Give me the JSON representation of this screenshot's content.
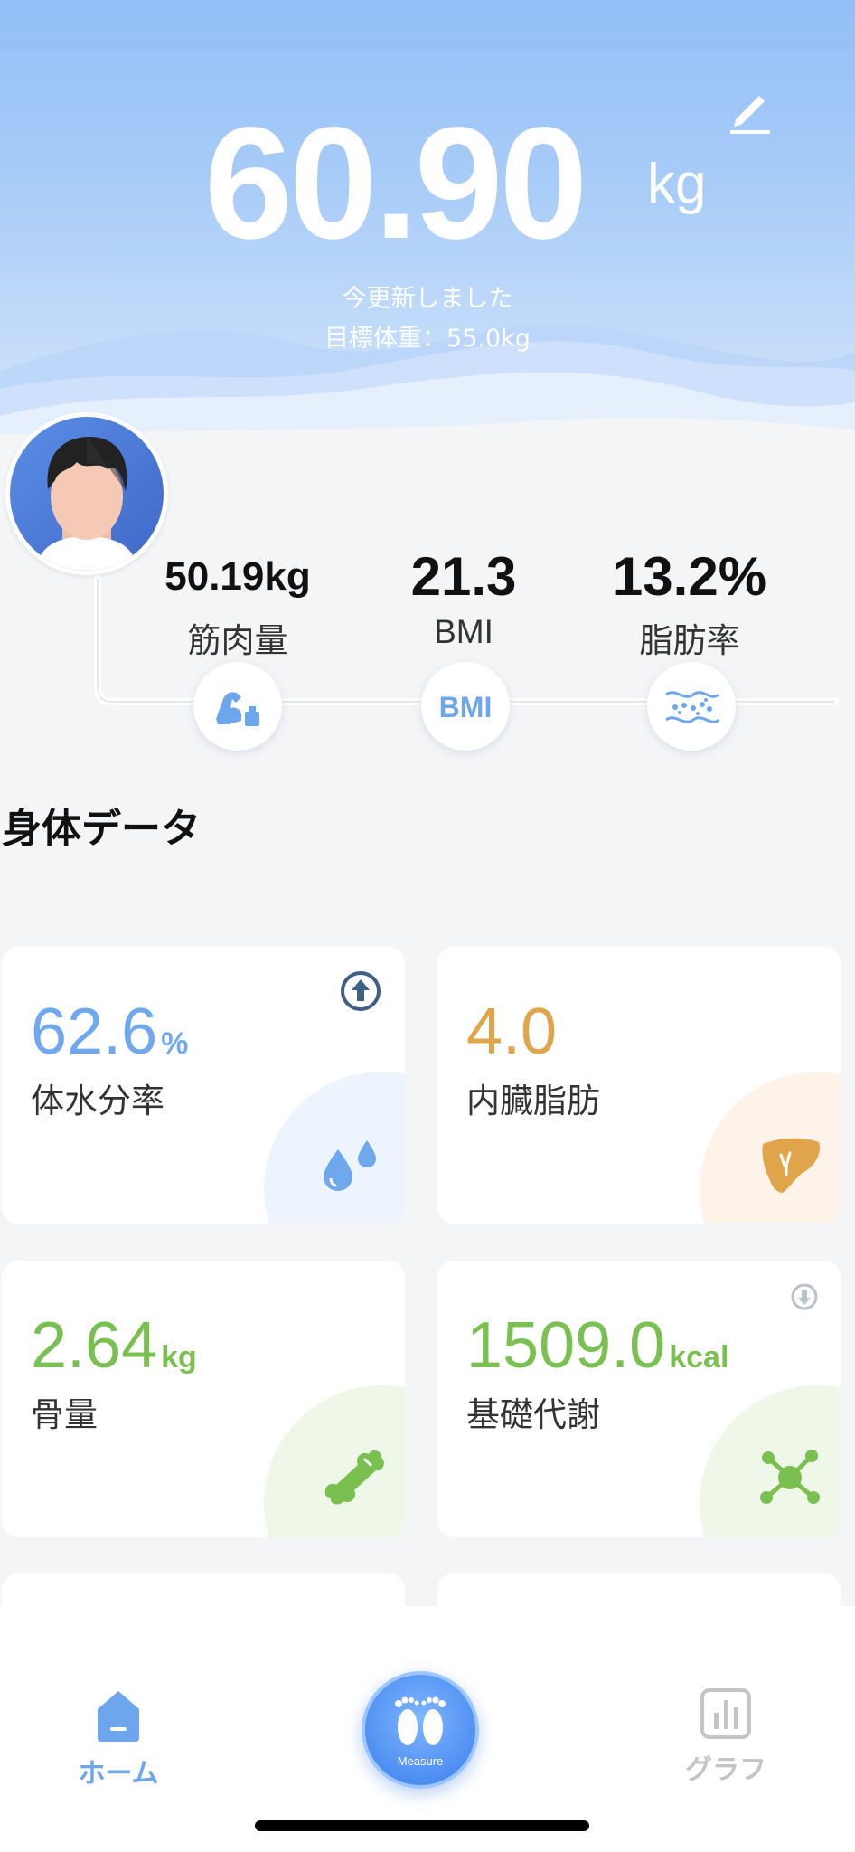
{
  "header": {
    "weight_value": "60.90",
    "weight_unit": "kg",
    "update_text": "今更新しました",
    "target_text": "目標体重：55.0kg"
  },
  "icons": {
    "edit": "pencil-icon",
    "muscle": "muscle-icon",
    "bmi": "bmi-icon",
    "fat": "fat-tissue-icon",
    "water": "water-drop-icon",
    "visceral": "liver-icon",
    "bone": "bone-icon",
    "metabolism": "molecule-icon",
    "home": "home-icon",
    "measure": "footprints-icon",
    "graph": "bar-chart-icon"
  },
  "metrics": [
    {
      "value": "50.19kg",
      "label": "筋肉量"
    },
    {
      "value": "21.3",
      "label": "BMI"
    },
    {
      "value": "13.2%",
      "label": "脂肪率"
    }
  ],
  "section_title": "身体データ",
  "cards": [
    {
      "value": "62.6",
      "unit": "%",
      "label": "体水分率",
      "color": "#6fa8ef",
      "trend": "up"
    },
    {
      "value": "4.0",
      "unit": "",
      "label": "内臓脂肪",
      "color": "#e0a54a",
      "trend": ""
    },
    {
      "value": "2.64",
      "unit": "kg",
      "label": "骨量",
      "color": "#7ac051",
      "trend": ""
    },
    {
      "value": "1509.0",
      "unit": "kcal",
      "label": "基礎代謝",
      "color": "#7ac051",
      "trend": "down"
    }
  ],
  "bottom_nav": {
    "home_label": "ホーム",
    "measure_label": "Measure",
    "graph_label": "グラフ"
  },
  "colors": {
    "accent_blue": "#6fa8ef",
    "orange": "#e0a54a",
    "green": "#7ac051",
    "nav_inactive": "#c4c4c4"
  }
}
